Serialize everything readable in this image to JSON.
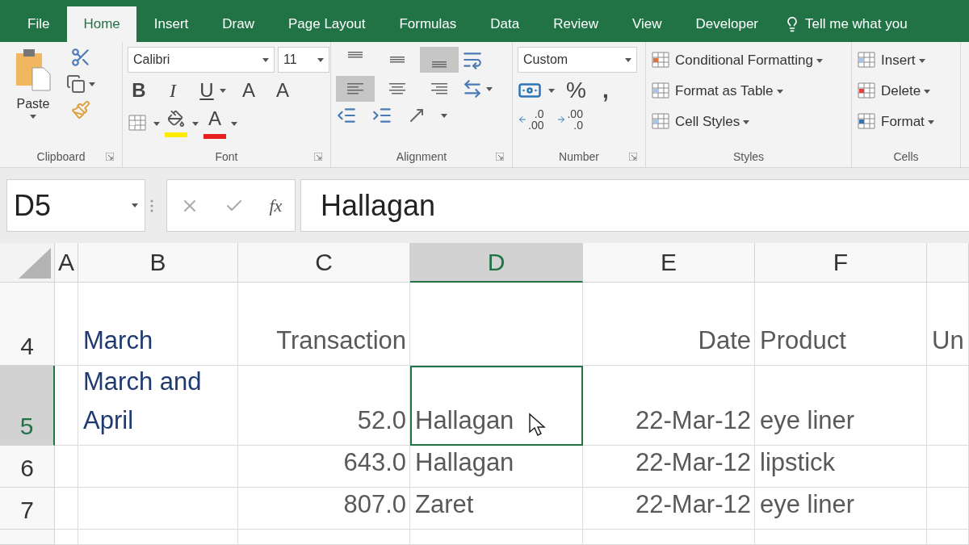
{
  "ribbon_tabs": [
    {
      "label": "File",
      "selected": false
    },
    {
      "label": "Home",
      "selected": true
    },
    {
      "label": "Insert",
      "selected": false
    },
    {
      "label": "Draw",
      "selected": false
    },
    {
      "label": "Page Layout",
      "selected": false
    },
    {
      "label": "Formulas",
      "selected": false
    },
    {
      "label": "Data",
      "selected": false
    },
    {
      "label": "Review",
      "selected": false
    },
    {
      "label": "View",
      "selected": false
    },
    {
      "label": "Developer",
      "selected": false
    }
  ],
  "tell_me": "Tell me what you",
  "ribbon_groups": [
    {
      "kind": "clipboard",
      "label": "Clipboard",
      "paste": "Paste"
    },
    {
      "kind": "font",
      "label": "Font",
      "font_name": "Calibri",
      "font_size": "11",
      "bold": "B",
      "italic": "I",
      "underline": "U",
      "grow": "A",
      "shrink": "A",
      "font_color": "A"
    },
    {
      "kind": "alignment",
      "label": "Alignment",
      "vertical": [
        {
          "selected": false
        },
        {
          "selected": false
        },
        {
          "selected": true
        }
      ],
      "horizontal": [
        {
          "selected": true
        },
        {
          "selected": false
        },
        {
          "selected": false
        }
      ]
    },
    {
      "kind": "number",
      "label": "Number",
      "format": "Custom",
      "percent": "%",
      "comma": ",",
      "increase_decimal": [
        ".0",
        ".00"
      ],
      "decrease_decimal": [
        ".00",
        ".0"
      ]
    },
    {
      "kind": "styles",
      "label": "Styles",
      "items": [
        "Conditional Formatting",
        "Format as Table",
        "Cell Styles"
      ]
    },
    {
      "kind": "cells",
      "label": "Cells",
      "items": [
        "Insert",
        "Delete",
        "Format"
      ]
    }
  ],
  "formula_bar": {
    "name_box": "D5",
    "function_label": "fx",
    "formula": "Hallagan"
  },
  "sheet": {
    "columns": [
      {
        "label": "A",
        "selected": false
      },
      {
        "label": "B",
        "selected": false
      },
      {
        "label": "C",
        "selected": false
      },
      {
        "label": "D",
        "selected": true
      },
      {
        "label": "E",
        "selected": false
      },
      {
        "label": "F",
        "selected": false
      }
    ],
    "rows": [
      {
        "label": "4",
        "selected": false,
        "cells": {
          "b": "March",
          "c": "Transaction",
          "e": "Date",
          "f": "Product",
          "g": "Un"
        }
      },
      {
        "label": "5",
        "selected": true,
        "cells": {
          "b": "March and April",
          "c": "52.0",
          "d": "Hallagan",
          "e": "22-Mar-12",
          "f": "eye liner"
        }
      },
      {
        "label": "6",
        "selected": false,
        "cells": {
          "c": "643.0",
          "d": "Hallagan",
          "e": "22-Mar-12",
          "f": "lipstick"
        }
      },
      {
        "label": "7",
        "selected": false,
        "cells": {
          "c": "807.0",
          "d": "Zaret",
          "e": "22-Mar-12",
          "f": "eye liner"
        }
      }
    ]
  }
}
